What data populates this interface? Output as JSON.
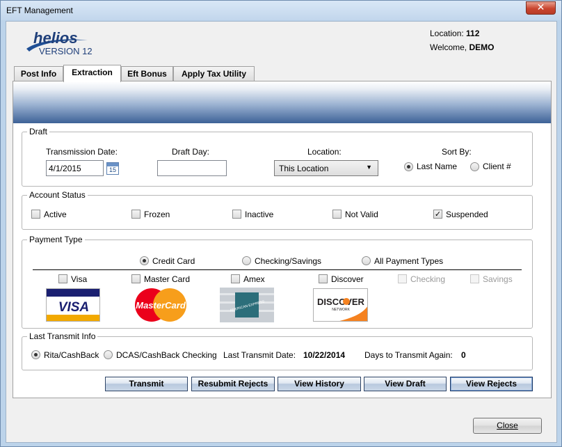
{
  "window": {
    "title": "EFT Management",
    "close_glyph": "✕"
  },
  "header": {
    "logo": {
      "brand": "helios",
      "version": "VERSION 12"
    },
    "location_label": "Location:",
    "location_value": "112",
    "welcome_label": "Welcome,",
    "welcome_value": "DEMO"
  },
  "tabs": [
    {
      "label": "Post Info",
      "active": false
    },
    {
      "label": "Extraction",
      "active": true
    },
    {
      "label": "Eft Bonus",
      "active": false
    },
    {
      "label": "Apply Tax Utility",
      "active": false
    }
  ],
  "draft": {
    "legend": "Draft",
    "transmission_date_label": "Transmission Date:",
    "transmission_date_value": "4/1/2015",
    "calendar_day": "15",
    "draft_day_label": "Draft Day:",
    "draft_day_value": "",
    "location_label": "Location:",
    "location_selected": "This Location",
    "sort_by_label": "Sort By:",
    "sort_options": [
      {
        "label": "Last Name",
        "selected": true
      },
      {
        "label": "Client #",
        "selected": false
      }
    ]
  },
  "account_status": {
    "legend": "Account Status",
    "options": [
      {
        "label": "Active",
        "checked": false
      },
      {
        "label": "Frozen",
        "checked": false
      },
      {
        "label": "Inactive",
        "checked": false
      },
      {
        "label": "Not Valid",
        "checked": false
      },
      {
        "label": "Suspended",
        "checked": true
      }
    ]
  },
  "payment_type": {
    "legend": "Payment Type",
    "types": [
      {
        "label": "Credit Card",
        "selected": true
      },
      {
        "label": "Checking/Savings",
        "selected": false
      },
      {
        "label": "All Payment Types",
        "selected": false
      }
    ],
    "cards": [
      {
        "label": "Visa",
        "checked": false,
        "enabled": true
      },
      {
        "label": "Master Card",
        "checked": false,
        "enabled": true
      },
      {
        "label": "Amex",
        "checked": false,
        "enabled": true
      },
      {
        "label": "Discover",
        "checked": false,
        "enabled": true
      },
      {
        "label": "Checking",
        "checked": false,
        "enabled": false
      },
      {
        "label": "Savings",
        "checked": false,
        "enabled": false
      }
    ],
    "logos": {
      "visa": "VISA",
      "mastercard": "MasterCard",
      "amex": "AMERICAN EXPRESS",
      "discover": "DISCOVER",
      "discover_sub": "NETWORK"
    }
  },
  "last_transmit": {
    "legend": "Last Transmit Info",
    "options": [
      {
        "label": "Rita/CashBack",
        "selected": true
      },
      {
        "label": "DCAS/CashBack Checking",
        "selected": false
      }
    ],
    "date_label": "Last Transmit Date:",
    "date_value": "10/22/2014",
    "days_label": "Days to Transmit Again:",
    "days_value": "0"
  },
  "actions": {
    "transmit": "Transmit",
    "resubmit_rejects": "Resubmit Rejects",
    "view_history": "View History",
    "view_draft": "View Draft",
    "view_rejects": "View Rejects"
  },
  "footer": {
    "close_label": "Close"
  },
  "colors": {
    "banner_dark": "#3d6197",
    "visa_blue": "#1a1f71",
    "mc_red": "#eb001b",
    "mc_orange": "#f79e1b",
    "discover_orange": "#f58220"
  }
}
